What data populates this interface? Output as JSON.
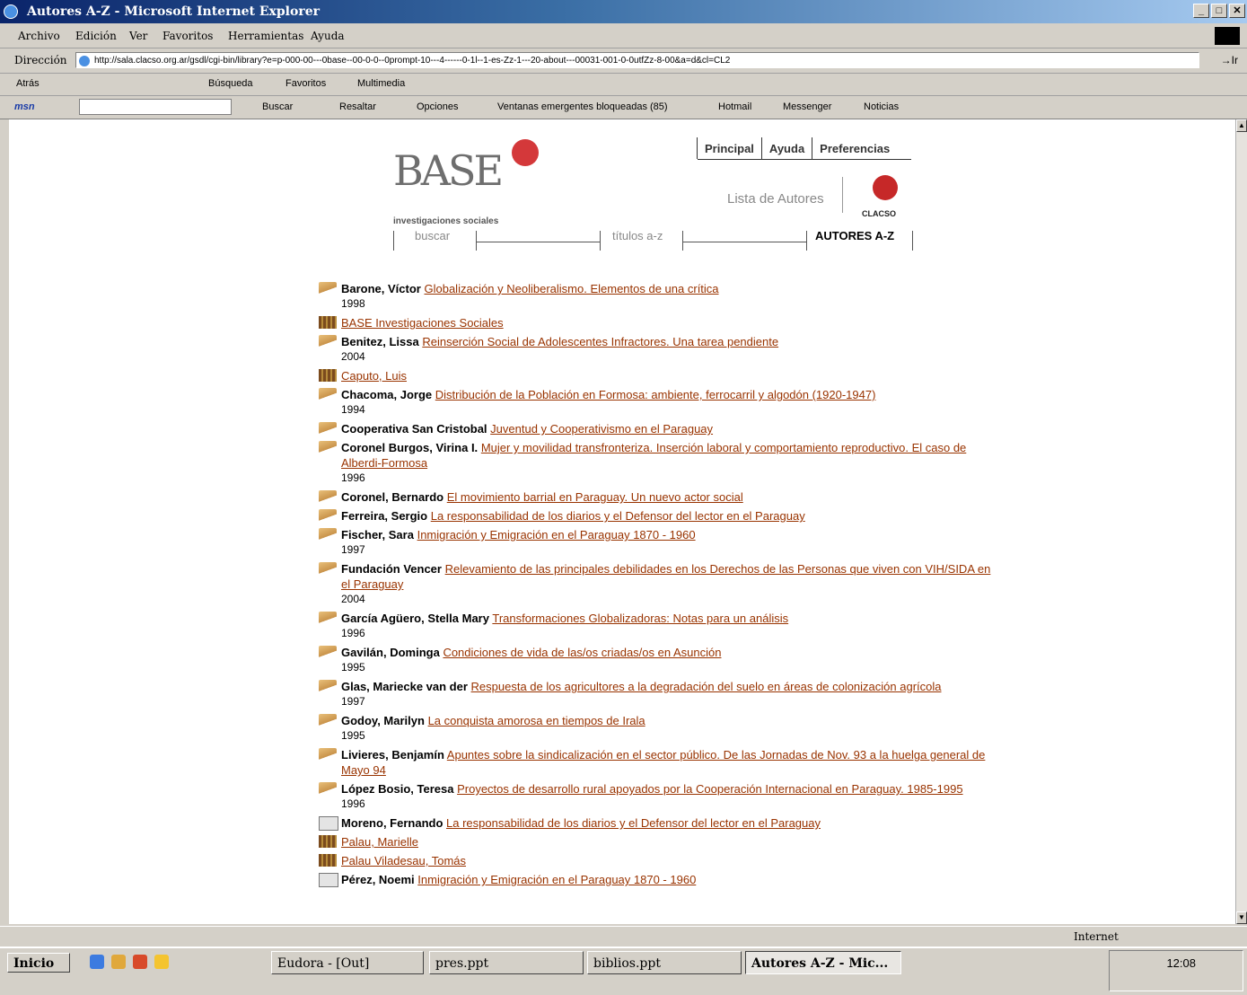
{
  "window": {
    "title": "Autores A-Z - Microsoft Internet Explorer",
    "controls": {
      "minimize": "_",
      "maximize": "□",
      "close": "✕"
    }
  },
  "menu": [
    "Archivo",
    "Edición",
    "Ver",
    "Favoritos",
    "Herramientas",
    "Ayuda"
  ],
  "address": {
    "label": "Dirección",
    "url": "http://sala.clacso.org.ar/gsdl/cgi-bin/library?e=p-000-00---0base--00-0-0--0prompt-10---4------0-1l--1-es-Zz-1---20-about---00031-001-0-0utfZz-8-00&a=d&cl=CL2",
    "go": "→Ir"
  },
  "toolbar": {
    "back": "Atrás",
    "search": "Búsqueda",
    "favorites": "Favoritos",
    "multimedia": "Multimedia"
  },
  "msn": {
    "logo": "msn",
    "buscar": "Buscar",
    "resaltar": "Resaltar",
    "opciones": "Opciones",
    "popups": "Ventanas emergentes bloqueadas (85)",
    "hotmail": "Hotmail",
    "messenger": "Messenger",
    "noticias": "Noticias"
  },
  "page": {
    "logo_text": "BASE",
    "logo_sub": "investigaciones sociales",
    "topnav": [
      "Principal",
      "Ayuda",
      "Preferencias"
    ],
    "lista": "Lista de Autores",
    "clacso": "CLACSO",
    "nav_buscar": "buscar",
    "nav_titulos": "títulos a-z",
    "nav_autores": "AUTORES A-Z"
  },
  "entries": [
    {
      "icon": "book",
      "author": "Barone, Víctor",
      "title": "Globalización y Neoliberalismo. Elementos de una crítica",
      "year": "1998"
    },
    {
      "icon": "shelf",
      "author": "",
      "title": "BASE Investigaciones Sociales",
      "year": ""
    },
    {
      "icon": "book",
      "author": "Benitez, Lissa",
      "title": "Reinserción Social de Adolescentes Infractores. Una tarea pendiente",
      "year": "2004"
    },
    {
      "icon": "shelf",
      "author": "",
      "title": "Caputo, Luis",
      "year": ""
    },
    {
      "icon": "book",
      "author": "Chacoma, Jorge",
      "title": "Distribución de la Población en Formosa: ambiente, ferrocarril y algodón (1920-1947)",
      "year": "1994"
    },
    {
      "icon": "book",
      "author": "Cooperativa San Cristobal",
      "title": "Juventud y Cooperativismo en el Paraguay",
      "year": ""
    },
    {
      "icon": "book",
      "author": "Coronel Burgos, Virina I.",
      "title": "Mujer y movilidad transfronteriza. Inserción laboral y comportamiento reproductivo. El caso de Alberdi-Formosa",
      "year": "1996"
    },
    {
      "icon": "book",
      "author": "Coronel, Bernardo",
      "title": "El movimiento barrial en Paraguay. Un nuevo actor social",
      "year": ""
    },
    {
      "icon": "book",
      "author": "Ferreira, Sergio",
      "title": "La responsabilidad de los diarios y el Defensor del lector en el Paraguay",
      "year": ""
    },
    {
      "icon": "book",
      "author": "Fischer, Sara",
      "title": "Inmigración y Emigración en el Paraguay 1870 - 1960",
      "year": "1997"
    },
    {
      "icon": "book",
      "author": "Fundación Vencer",
      "title": "Relevamiento de las principales debilidades en los Derechos de las Personas que viven con VIH/SIDA en el Paraguay",
      "year": "2004"
    },
    {
      "icon": "book",
      "author": "García Agüero, Stella Mary",
      "title": "Transformaciones Globalizadoras: Notas para un análisis",
      "year": "1996"
    },
    {
      "icon": "book",
      "author": "Gavilán, Dominga",
      "title": "Condiciones de vida de las/os criadas/os en Asunción",
      "year": "1995"
    },
    {
      "icon": "book",
      "author": "Glas, Mariecke van der",
      "title": "Respuesta de los agricultores a la degradación del suelo en áreas de colonización agrícola",
      "year": "1997"
    },
    {
      "icon": "book",
      "author": "Godoy, Marilyn",
      "title": "La conquista amorosa en tiempos de Irala",
      "year": "1995"
    },
    {
      "icon": "book",
      "author": "Livieres, Benjamín",
      "title": "Apuntes sobre la sindicalización en el sector público. De las Jornadas de Nov. 93 a la huelga general de Mayo 94",
      "year": ""
    },
    {
      "icon": "book",
      "author": "López Bosio, Teresa",
      "title": "Proyectos de desarrollo rural apoyados por la Cooperación Internacional en Paraguay. 1985-1995",
      "year": "1996"
    },
    {
      "icon": "doc",
      "author": "Moreno, Fernando",
      "title": "La responsabilidad de los diarios y el Defensor del lector en el Paraguay",
      "year": ""
    },
    {
      "icon": "shelf",
      "author": "",
      "title": "Palau, Marielle",
      "year": ""
    },
    {
      "icon": "shelf",
      "author": "",
      "title": "Palau Viladesau, Tomás",
      "year": ""
    },
    {
      "icon": "doc",
      "author": "Pérez, Noemi",
      "title": "Inmigración y Emigración en el Paraguay 1870 - 1960",
      "year": ""
    }
  ],
  "status": {
    "zone": "Internet"
  },
  "taskbar": {
    "start": "Inicio",
    "tasks": [
      "Eudora - [Out]",
      "pres.ppt",
      "biblios.ppt",
      "Autores A-Z - Mic..."
    ],
    "clock": "12:08"
  }
}
